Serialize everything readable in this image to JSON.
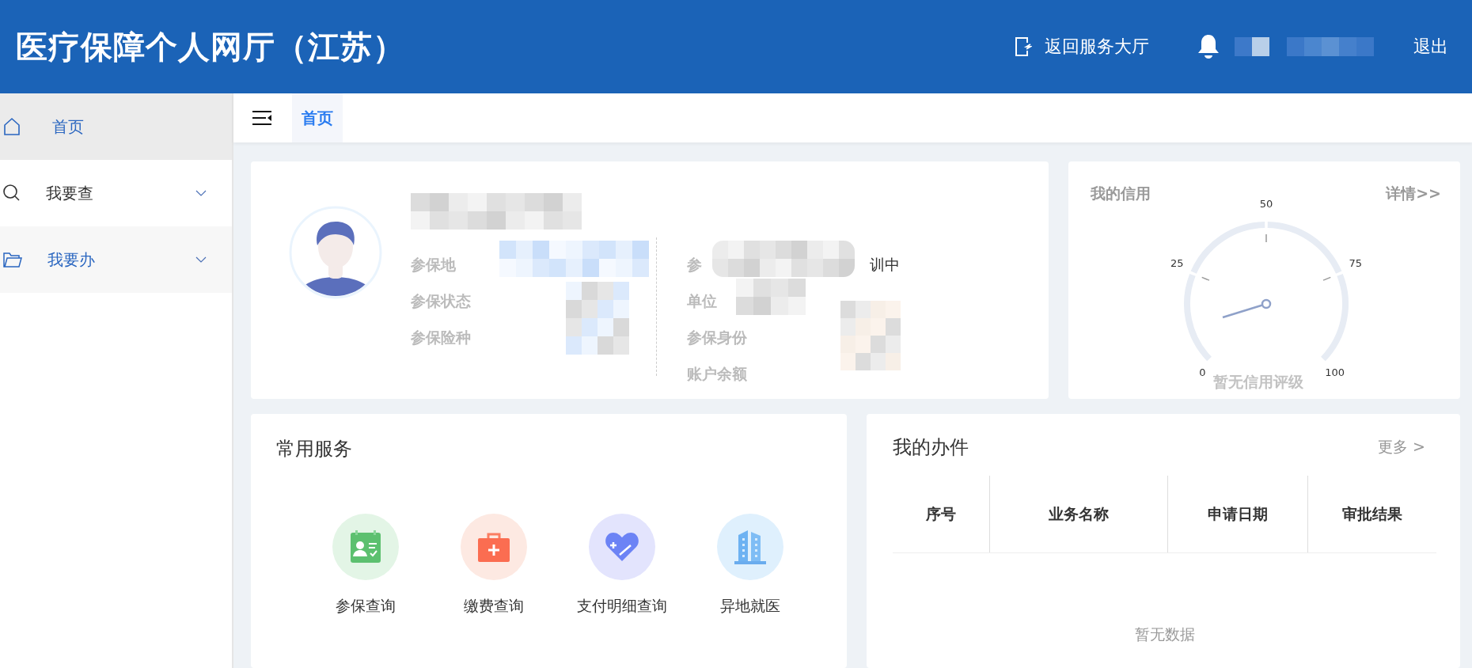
{
  "header": {
    "title": "医疗保障个人网厅（江苏）",
    "back_link": "返回服务大厅",
    "logout": "退出"
  },
  "sidebar": {
    "items": [
      {
        "label": "首页",
        "selected": true,
        "highlighted": false,
        "expandable": false
      },
      {
        "label": "我要查",
        "selected": false,
        "highlighted": false,
        "expandable": true
      },
      {
        "label": "我要办",
        "selected": false,
        "highlighted": true,
        "expandable": true
      }
    ]
  },
  "tabs": [
    {
      "label": "首页",
      "selected": true
    }
  ],
  "profile": {
    "left_fields": [
      {
        "label": "参保地"
      },
      {
        "label": "参保状态"
      },
      {
        "label": "参保险种"
      }
    ],
    "right_fields": [
      {
        "label": "参",
        "value": "训中"
      },
      {
        "label": "单位"
      },
      {
        "label": "参保身份"
      },
      {
        "label": "账户余额"
      }
    ]
  },
  "credit": {
    "title": "我的信用",
    "details_link": "详情>>",
    "gauge_labels": [
      "0",
      "25",
      "50",
      "75",
      "100"
    ],
    "status": "暂无信用评级"
  },
  "services": {
    "title": "常用服务",
    "items": [
      {
        "label": "参保查询",
        "color": "#e3f5e6"
      },
      {
        "label": "缴费查询",
        "color": "#fde9e2"
      },
      {
        "label": "支付明细查询",
        "color": "#e3e4fd"
      },
      {
        "label": "异地就医",
        "color": "#dff0fd"
      }
    ]
  },
  "my_items": {
    "title": "我的办件",
    "more_link": "更多 >",
    "columns": [
      "序号",
      "业务名称",
      "申请日期",
      "审批结果"
    ],
    "empty_text": "暂无数据"
  }
}
